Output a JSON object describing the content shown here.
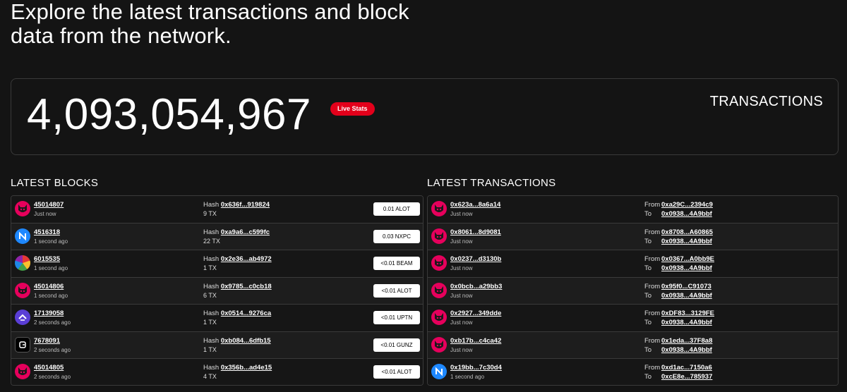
{
  "headline": "Explore the latest transactions and block data from the network.",
  "stats": {
    "count": "4,093,054,967",
    "badge": "Live Stats",
    "label": "TRANSACTIONS"
  },
  "latest_blocks": {
    "title": "LATEST BLOCKS",
    "hash_label": "Hash",
    "items": [
      {
        "icon": "cat-icon",
        "number": "45014807",
        "time": "Just now",
        "hash": "0x636f...919824",
        "tx": "9 TX",
        "amount": "0.01 ALOT"
      },
      {
        "icon": "nxpc-icon",
        "number": "4516318",
        "time": "1 second ago",
        "hash": "0xa9a6...c599fc",
        "tx": "22 TX",
        "amount": "0.03 NXPC"
      },
      {
        "icon": "beam-icon",
        "number": "6015535",
        "time": "1 second ago",
        "hash": "0x2e36...ab4972",
        "tx": "1 TX",
        "amount": "<0.01 BEAM"
      },
      {
        "icon": "cat-icon",
        "number": "45014806",
        "time": "1 second ago",
        "hash": "0x9785...c0cb18",
        "tx": "6 TX",
        "amount": "<0.01 ALOT"
      },
      {
        "icon": "uptn-icon",
        "number": "17139058",
        "time": "2 seconds ago",
        "hash": "0x0514...9276ca",
        "tx": "1 TX",
        "amount": "<0.01 UPTN"
      },
      {
        "icon": "gunz-icon",
        "number": "7678091",
        "time": "2 seconds ago",
        "hash": "0xb084...6dfb15",
        "tx": "1 TX",
        "amount": "<0.01 GUNZ"
      },
      {
        "icon": "cat-icon",
        "number": "45014805",
        "time": "2 seconds ago",
        "hash": "0x356b...ad4e15",
        "tx": "4 TX",
        "amount": "<0.01 ALOT"
      }
    ]
  },
  "latest_transactions": {
    "title": "LATEST TRANSACTIONS",
    "from_label": "From",
    "to_label": "To",
    "items": [
      {
        "icon": "cat-icon",
        "hash": "0x623a...8a6a14",
        "time": "Just now",
        "from": "0xa29C...2394c9",
        "to": "0x0938...4A9bbf"
      },
      {
        "icon": "cat-icon",
        "hash": "0x8061...8d9081",
        "time": "Just now",
        "from": "0x8708...A60865",
        "to": "0x0938...4A9bbf"
      },
      {
        "icon": "cat-icon",
        "hash": "0x0237...d3130b",
        "time": "Just now",
        "from": "0x0367...A0bb9E",
        "to": "0x0938...4A9bbf"
      },
      {
        "icon": "cat-icon",
        "hash": "0x0bcb...a29bb3",
        "time": "Just now",
        "from": "0x95f0...C91073",
        "to": "0x0938...4A9bbf"
      },
      {
        "icon": "cat-icon",
        "hash": "0x2927...349dde",
        "time": "Just now",
        "from": "0xDF83...3129FE",
        "to": "0x0938...4A9bbf"
      },
      {
        "icon": "cat-icon",
        "hash": "0xb17b...c4ca42",
        "time": "Just now",
        "from": "0x1eda...37F8a8",
        "to": "0x0938...4A9bbf"
      },
      {
        "icon": "nxpc-icon",
        "hash": "0x19bb...7c30d4",
        "time": "1 second ago",
        "from": "0xd1ac...7150a6",
        "to": "0xcE8e...785937"
      }
    ]
  }
}
